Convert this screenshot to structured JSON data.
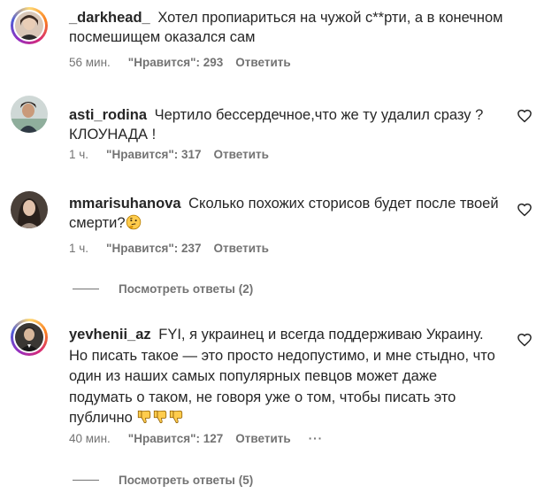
{
  "comments": [
    {
      "username": "_darkhead_",
      "text": "Хотел пропиариться на чужой с**рти, а в конечном посмешищем оказался сам",
      "time": "56 мин.",
      "likes": "\"Нравится\": 293",
      "reply": "Ответить"
    },
    {
      "username": "asti_rodina",
      "text": "Чертило бессердечное,что же ту удалил сразу ? КЛОУНАДА !",
      "time": "1 ч.",
      "likes": "\"Нравится\": 317",
      "reply": "Ответить"
    },
    {
      "username": "mmarisuhanova",
      "text": "Сколько похожих сторисов будет после твоей смерти?",
      "time": "1 ч.",
      "likes": "\"Нравится\": 237",
      "reply": "Ответить",
      "view_replies": "Посмотреть ответы (2)"
    },
    {
      "username": "yevhenii_az",
      "text": "FYI, я украинец и всегда поддерживаю Украину. Но писать такое — это просто недопустимо, и мне стыдно, что один из наших самых популярных певцов может даже подумать о таком, не говоря уже о том, чтобы писать это публично",
      "time": "40 мин.",
      "likes": "\"Нравится\": 127",
      "reply": "Ответить",
      "more": "···",
      "view_replies": "Посмотреть ответы (5)"
    }
  ],
  "icons": {
    "like": "heart-outline-icon",
    "thinking_emoji": "thinking-face-emoji",
    "dislike_emoji": "thumbs-down-emoji"
  },
  "colors": {
    "text": "#262626",
    "secondary": "#737373",
    "story_ring": "#d62976"
  }
}
